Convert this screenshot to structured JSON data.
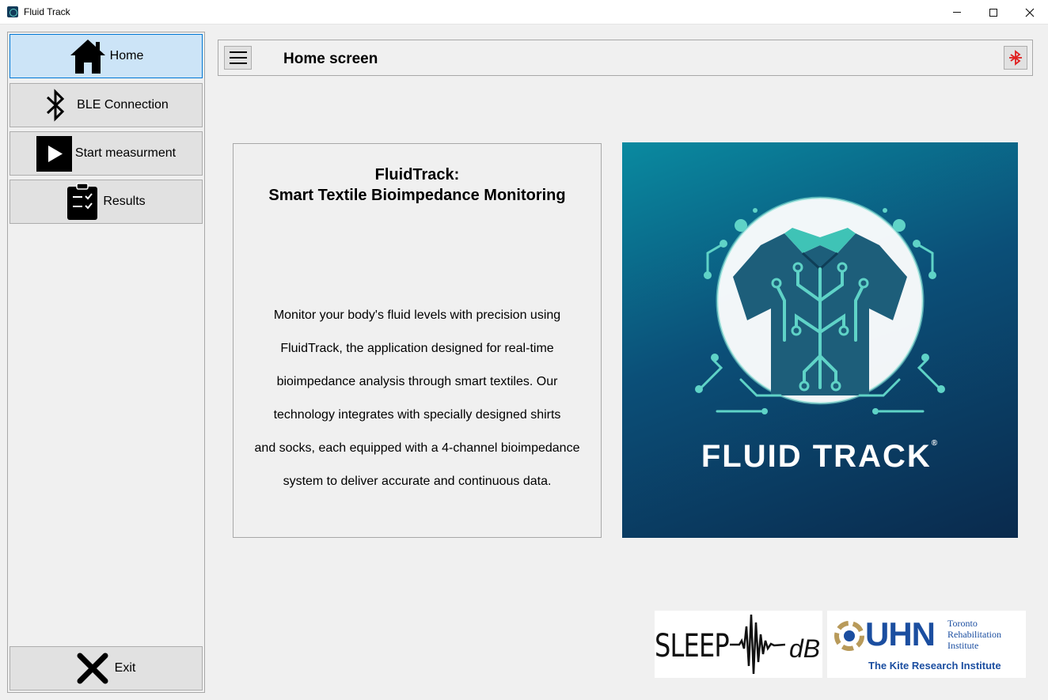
{
  "window": {
    "title": "Fluid Track",
    "controls": [
      "minimize",
      "maximize",
      "close"
    ]
  },
  "sidebar": {
    "items": [
      {
        "label": "Home",
        "icon": "home-icon",
        "active": true
      },
      {
        "label": "BLE Connection",
        "icon": "bluetooth-icon",
        "active": false
      },
      {
        "label": "Start measurment",
        "icon": "play-icon",
        "active": false
      },
      {
        "label": "Results",
        "icon": "clipboard-check-icon",
        "active": false
      }
    ],
    "exit": {
      "label": "Exit",
      "icon": "close-x-icon"
    }
  },
  "header": {
    "title": "Home screen",
    "menu_icon": "hamburger-menu-icon",
    "status_icon": "bluetooth-disconnected-icon"
  },
  "card": {
    "heading_line1": "FluidTrack:",
    "heading_line2": "Smart Textile Bioimpedance Monitoring",
    "lines": [
      "Monitor your body's fluid levels with precision using",
      "FluidTrack, the application designed for real-time",
      "bioimpedance analysis through smart textiles. Our",
      "technology integrates with specially designed shirts",
      "and socks, each equipped with a 4-channel bioimpedance",
      "system to deliver accurate and continuous data."
    ]
  },
  "logo": {
    "brand_text": "FLUID TRACK",
    "trademark": "®"
  },
  "partners": {
    "sleep_left": "SLEEP",
    "sleep_right": "dB",
    "uhn_name": "UHN",
    "uhn_line1": "Toronto",
    "uhn_line2": "Rehabilitation",
    "uhn_line3": "Institute",
    "uhn_tagline": "The Kite Research Institute"
  },
  "colors": {
    "active_nav": "#cce4f7",
    "active_border": "#0078d7",
    "bt_status": "#e02020",
    "brand_teal": "#5fd3c7",
    "uhn_blue": "#1b4ea0",
    "uhn_gold": "#b89a5a"
  }
}
